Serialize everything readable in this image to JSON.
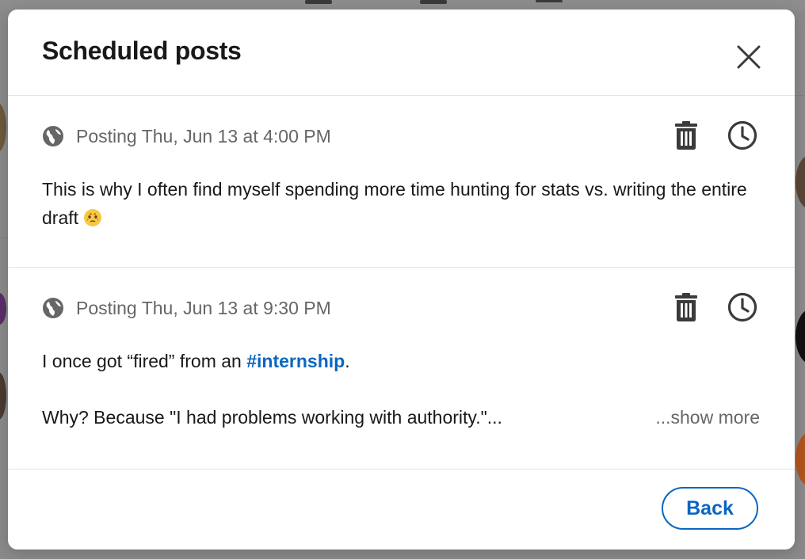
{
  "modal": {
    "title": "Scheduled posts",
    "close_icon": "close-icon"
  },
  "posts": [
    {
      "visibility_icon": "globe-icon",
      "posting_time": "Posting Thu, Jun 13 at 4:00 PM",
      "text": "This is why I often find myself spending more time hunting for stats vs. writing the entire draft",
      "emoji": "face-holding-back-tears",
      "delete_icon": "trash-icon",
      "reschedule_icon": "clock-icon"
    },
    {
      "visibility_icon": "globe-icon",
      "posting_time": "Posting Thu, Jun 13 at 9:30 PM",
      "text_before_hashtag": "I once got “fired” from an ",
      "hashtag": "#internship",
      "text_after_hashtag": ".",
      "second_line": "Why? Because \"I had problems working with authority.\"...",
      "show_more": "...show more",
      "delete_icon": "trash-icon",
      "reschedule_icon": "clock-icon"
    }
  ],
  "footer": {
    "back_label": "Back"
  },
  "colors": {
    "accent": "#0a66c2",
    "muted_text": "#666666",
    "primary_text": "#191919",
    "overlay": "#8a8a8a"
  }
}
